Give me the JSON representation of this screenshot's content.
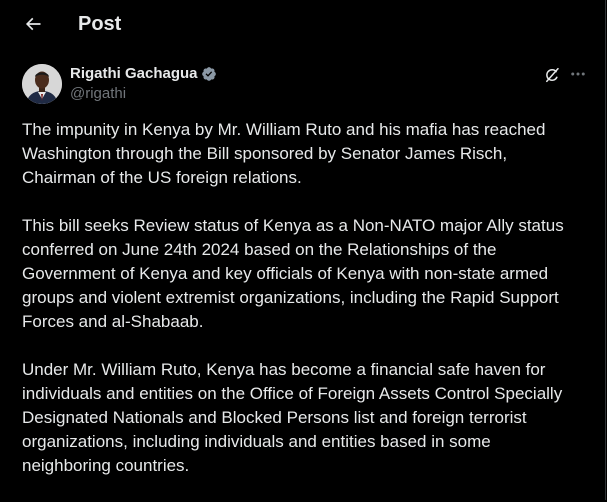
{
  "header": {
    "title": "Post",
    "back_icon": "arrow-left-icon"
  },
  "author": {
    "name": "Rigathi Gachagua",
    "handle": "@rigathi",
    "verified": true,
    "verified_color": "#8b98a5"
  },
  "actions": {
    "grok_icon": "grok-icon",
    "more_icon": "more-horizontal-icon"
  },
  "post": {
    "paragraphs": [
      "The impunity in Kenya by Mr. William Ruto and his mafia has reached\nWashington through the Bill sponsored by Senator James Risch,\nChairman of the US foreign relations.",
      "This bill seeks Review status of Kenya as a Non-NATO major Ally status\nconferred on June 24th 2024 based on the Relationships of the\nGovernment of Kenya and key officials of Kenya with non-state armed\ngroups and violent extremist organizations, including the Rapid Support\nForces and al-Shabaab.",
      "Under Mr. William Ruto, Kenya has become a financial safe haven for\nindividuals and entities on the Office of Foreign Assets Control Specially\nDesignated Nationals and Blocked Persons list and foreign terrorist\norganizations, including individuals and entities based in some\nneighboring countries."
    ]
  },
  "colors": {
    "background": "#000000",
    "text_primary": "#e7e9ea",
    "text_secondary": "#71767b",
    "border": "#2f3336"
  }
}
